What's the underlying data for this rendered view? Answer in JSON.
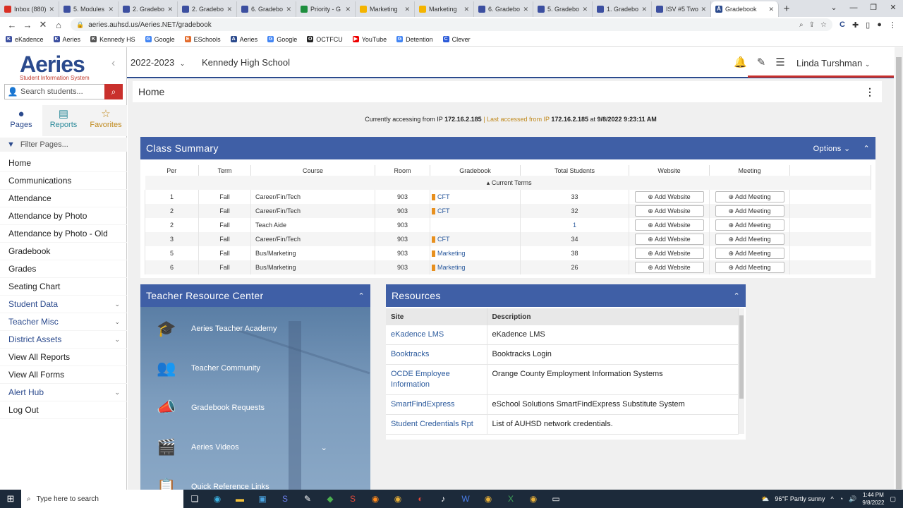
{
  "browser": {
    "tabs": [
      {
        "label": "Inbox (880)",
        "icon": "gmail-icon",
        "color": "#d93025"
      },
      {
        "label": "5. Modules",
        "icon": "k-icon",
        "color": "#3c4fa0"
      },
      {
        "label": "2. Gradebo",
        "icon": "k-icon",
        "color": "#3c4fa0"
      },
      {
        "label": "2. Gradebo",
        "icon": "k-icon",
        "color": "#3c4fa0"
      },
      {
        "label": "6. Gradebo",
        "icon": "k-icon",
        "color": "#3c4fa0"
      },
      {
        "label": "Priority - G",
        "icon": "drive-icon",
        "color": "#1e8e3e"
      },
      {
        "label": "Marketing",
        "icon": "slides-icon",
        "color": "#f4b400"
      },
      {
        "label": "Marketing",
        "icon": "slides-icon",
        "color": "#f4b400"
      },
      {
        "label": "6. Gradebo",
        "icon": "k-icon",
        "color": "#3c4fa0"
      },
      {
        "label": "5. Gradebo",
        "icon": "k-icon",
        "color": "#3c4fa0"
      },
      {
        "label": "1. Gradebo",
        "icon": "k-icon",
        "color": "#3c4fa0"
      },
      {
        "label": "ISV #5 Two",
        "icon": "k-icon",
        "color": "#3c4fa0"
      }
    ],
    "active_tab": "Gradebook",
    "url": "aeries.auhsd.us/Aeries.NET/gradebook",
    "bookmarks": [
      {
        "label": "eKadence",
        "color": "#3c4fa0",
        "glyph": "K"
      },
      {
        "label": "Aeries",
        "color": "#3c4fa0",
        "glyph": "K"
      },
      {
        "label": "Kennedy HS",
        "color": "#555",
        "glyph": "K"
      },
      {
        "label": "Google",
        "color": "#4285f4",
        "glyph": "G"
      },
      {
        "label": "ESchools",
        "color": "#e36b2b",
        "glyph": "E"
      },
      {
        "label": "Aeries",
        "color": "#2b4a8d",
        "glyph": "A"
      },
      {
        "label": "Google",
        "color": "#4285f4",
        "glyph": "G"
      },
      {
        "label": "OCTFCU",
        "color": "#222",
        "glyph": "O"
      },
      {
        "label": "YouTube",
        "color": "#e00",
        "glyph": "▶"
      },
      {
        "label": "Detention",
        "color": "#4285f4",
        "glyph": "G"
      },
      {
        "label": "Clever",
        "color": "#2b5ad8",
        "glyph": "C"
      }
    ]
  },
  "sidebar": {
    "logo_main": "Aeries",
    "logo_sub": "Student Information System",
    "search_placeholder": "Search students...",
    "tabs": [
      {
        "label": "Pages",
        "icon": "●"
      },
      {
        "label": "Reports",
        "icon": "▤"
      },
      {
        "label": "Favorites",
        "icon": "☆"
      }
    ],
    "filter_placeholder": "Filter Pages...",
    "menu": [
      {
        "label": "Home",
        "chevron": false,
        "blue": false
      },
      {
        "label": "Communications",
        "chevron": false,
        "blue": false
      },
      {
        "label": "Attendance",
        "chevron": false,
        "blue": false
      },
      {
        "label": "Attendance by Photo",
        "chevron": false,
        "blue": false
      },
      {
        "label": "Attendance by Photo - Old",
        "chevron": false,
        "blue": false
      },
      {
        "label": "Gradebook",
        "chevron": false,
        "blue": false
      },
      {
        "label": "Grades",
        "chevron": false,
        "blue": false
      },
      {
        "label": "Seating Chart",
        "chevron": false,
        "blue": false
      },
      {
        "label": "Student Data",
        "chevron": true,
        "blue": true
      },
      {
        "label": "Teacher Misc",
        "chevron": true,
        "blue": true
      },
      {
        "label": "District Assets",
        "chevron": true,
        "blue": true
      },
      {
        "label": "View All Reports",
        "chevron": false,
        "blue": false
      },
      {
        "label": "View All Forms",
        "chevron": false,
        "blue": false
      },
      {
        "label": "Alert Hub",
        "chevron": true,
        "blue": true
      },
      {
        "label": "Log Out",
        "chevron": false,
        "blue": false
      }
    ]
  },
  "header": {
    "year": "2022-2023",
    "school": "Kennedy High School",
    "user": "Linda Turshman"
  },
  "page": {
    "title": "Home",
    "ip_prefix": "Currently accessing from IP",
    "ip_current": "172.16.2.185",
    "ip_mid": "| Last accessed from IP",
    "ip_last": "172.16.2.185",
    "ip_at": "at",
    "ip_time": "9/8/2022 9:23:11 AM"
  },
  "class_summary": {
    "title": "Class Summary",
    "options_label": "Options",
    "columns": [
      "Per",
      "Term",
      "Course",
      "Room",
      "Gradebook",
      "Total Students",
      "Website",
      "Meeting"
    ],
    "group_label": "Current Terms",
    "website_btn": "Add Website",
    "meeting_btn": "Add Meeting",
    "rows": [
      {
        "per": "1",
        "term": "Fall",
        "course": "Career/Fin/Tech",
        "room": "903",
        "gradebook": "CFT",
        "students": "33"
      },
      {
        "per": "2",
        "term": "Fall",
        "course": "Career/Fin/Tech",
        "room": "903",
        "gradebook": "CFT",
        "students": "32"
      },
      {
        "per": "2",
        "term": "Fall",
        "course": "Teach Aide",
        "room": "903",
        "gradebook": "",
        "students": "1"
      },
      {
        "per": "3",
        "term": "Fall",
        "course": "Career/Fin/Tech",
        "room": "903",
        "gradebook": "CFT",
        "students": "34"
      },
      {
        "per": "5",
        "term": "Fall",
        "course": "Bus/Marketing",
        "room": "903",
        "gradebook": "Marketing",
        "students": "38"
      },
      {
        "per": "6",
        "term": "Fall",
        "course": "Bus/Marketing",
        "room": "903",
        "gradebook": "Marketing",
        "students": "26"
      }
    ]
  },
  "teacher_resource": {
    "title": "Teacher Resource Center",
    "items": [
      {
        "label": "Aeries Teacher Academy",
        "icon": "🎓"
      },
      {
        "label": "Teacher Community",
        "icon": "👥"
      },
      {
        "label": "Gradebook Requests",
        "icon": "📣"
      },
      {
        "label": "Aeries Videos",
        "icon": "🎬"
      },
      {
        "label": "Quick Reference Links",
        "icon": "📋"
      }
    ]
  },
  "resources": {
    "title": "Resources",
    "columns": [
      "Site",
      "Description"
    ],
    "rows": [
      {
        "site": "eKadence LMS",
        "desc": "eKadence LMS"
      },
      {
        "site": "Booktracks",
        "desc": "Booktracks Login"
      },
      {
        "site": "OCDE Employee Information",
        "desc": "Orange County Employment Information Systems"
      },
      {
        "site": "SmartFindExpress",
        "desc": "eSchool Solutions SmartFindExpress Substitute System"
      },
      {
        "site": "Student Credentials Rpt",
        "desc": "List of AUHSD network credentials."
      }
    ]
  },
  "taskbar": {
    "search_placeholder": "Type here to search",
    "weather": "96°F  Partly sunny",
    "time": "1:44 PM",
    "date": "9/8/2022"
  },
  "colors": {
    "brand": "#2b4a8d",
    "panel_header": "#3f5fa6",
    "gradebook_marker": "#e8901e",
    "alert_red": "#c9302c"
  }
}
